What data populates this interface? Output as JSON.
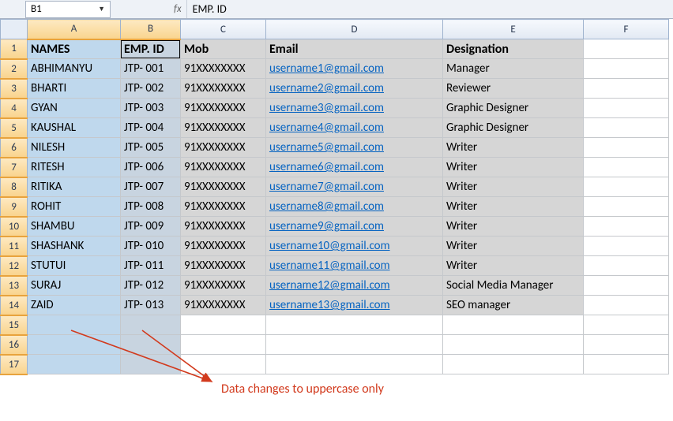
{
  "name_box": {
    "ref": "B1"
  },
  "formula_bar": {
    "fx": "fx",
    "value": "EMP. ID"
  },
  "columns": [
    "A",
    "B",
    "C",
    "D",
    "E",
    "F"
  ],
  "col_widths": {
    "corner": 34,
    "A": 118,
    "B": 76,
    "C": 108,
    "D": 224,
    "E": 178,
    "F": 108
  },
  "headers": {
    "A": "NAMES",
    "B": "EMP. ID",
    "C": "Mob",
    "D": "Email",
    "E": "Designation"
  },
  "rows": [
    {
      "A": "ABHIMANYU",
      "B": "JTP- 001",
      "C": "91XXXXXXXX",
      "D": "username1@gmail.com",
      "E": "Manager"
    },
    {
      "A": "BHARTI",
      "B": "JTP- 002",
      "C": "91XXXXXXXX",
      "D": "username2@gmail.com",
      "E": "Reviewer"
    },
    {
      "A": "GYAN",
      "B": "JTP- 003",
      "C": "91XXXXXXXX",
      "D": "username3@gmail.com",
      "E": "Graphic Designer"
    },
    {
      "A": "KAUSHAL",
      "B": "JTP- 004",
      "C": "91XXXXXXXX",
      "D": "username4@gmail.com",
      "E": "Graphic Designer"
    },
    {
      "A": "NILESH",
      "B": "JTP- 005",
      "C": "91XXXXXXXX",
      "D": "username5@gmail.com",
      "E": "Writer"
    },
    {
      "A": "RITESH",
      "B": "JTP- 006",
      "C": "91XXXXXXXX",
      "D": "username6@gmail.com",
      "E": "Writer"
    },
    {
      "A": "RITIKA",
      "B": "JTP- 007",
      "C": "91XXXXXXXX",
      "D": "username7@gmail.com",
      "E": "Writer"
    },
    {
      "A": "ROHIT",
      "B": "JTP- 008",
      "C": "91XXXXXXXX",
      "D": "username8@gmail.com",
      "E": "Writer"
    },
    {
      "A": "SHAMBU",
      "B": "JTP- 009",
      "C": "91XXXXXXXX",
      "D": "username9@gmail.com",
      "E": "Writer"
    },
    {
      "A": "SHASHANK",
      "B": "JTP- 010",
      "C": "91XXXXXXXX",
      "D": "username10@gmail.com",
      "E": "Writer"
    },
    {
      "A": "STUTUI",
      "B": "JTP- 011",
      "C": "91XXXXXXXX",
      "D": "username11@gmail.com",
      "E": "Writer"
    },
    {
      "A": "SURAJ",
      "B": "JTP- 012",
      "C": "91XXXXXXXX",
      "D": "username12@gmail.com",
      "E": "Social Media Manager"
    },
    {
      "A": "ZAID",
      "B": "JTP- 013",
      "C": "91XXXXXXXX",
      "D": "username13@gmail.com",
      "E": "SEO manager"
    }
  ],
  "empty_rows": [
    15,
    16,
    17
  ],
  "selection": {
    "active": "B1",
    "range": "A1:B17"
  },
  "annotation": "Data changes to uppercase only"
}
